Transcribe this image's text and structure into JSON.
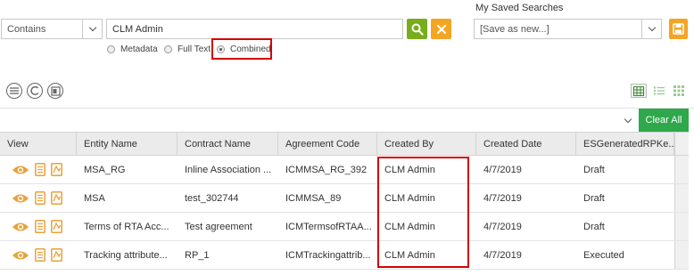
{
  "search": {
    "operator": "Contains",
    "query": "CLM Admin",
    "modes": [
      {
        "label": "Metadata",
        "checked": false
      },
      {
        "label": "Full Text",
        "checked": false
      },
      {
        "label": "Combined",
        "checked": true
      }
    ]
  },
  "saved_searches": {
    "label": "My Saved Searches",
    "selected": "[Save as new...]"
  },
  "toolbar": {
    "clear_all_label": "Clear All"
  },
  "table": {
    "columns": [
      "View",
      "Entity Name",
      "Contract Name",
      "Agreement Code",
      "Created By",
      "Created Date",
      "ESGeneratedRPKe..."
    ],
    "rows": [
      {
        "entity": "MSA_RG",
        "contract": "Inline Association ...",
        "code": "ICMMSA_RG_392",
        "created_by": "CLM Admin",
        "date": "4/7/2019",
        "status": "Draft"
      },
      {
        "entity": "MSA",
        "contract": "test_302744",
        "code": "ICMMSA_89",
        "created_by": "CLM Admin",
        "date": "4/7/2019",
        "status": "Draft"
      },
      {
        "entity": "Terms of RTA Acc...",
        "contract": "Test agreement",
        "code": "ICMTermsofRTAA...",
        "created_by": "CLM Admin",
        "date": "4/7/2019",
        "status": "Draft"
      },
      {
        "entity": "Tracking attribute...",
        "contract": "RP_1",
        "code": "ICMTrackingattrib...",
        "created_by": "CLM Admin",
        "date": "4/7/2019",
        "status": "Executed"
      }
    ]
  },
  "colors": {
    "search_button": "#77ad1c",
    "clear_button": "#f4a523",
    "clear_all": "#2ea84a",
    "highlight": "#d40000",
    "icon_orange": "#e8a13a"
  },
  "icons": [
    "search-icon",
    "clear-x-icon",
    "save-icon",
    "list-view-icon",
    "refresh-icon",
    "export-icon",
    "grid-view-icon",
    "compact-list-icon",
    "tile-view-icon",
    "eye-icon",
    "document-icon",
    "contract-icon"
  ]
}
